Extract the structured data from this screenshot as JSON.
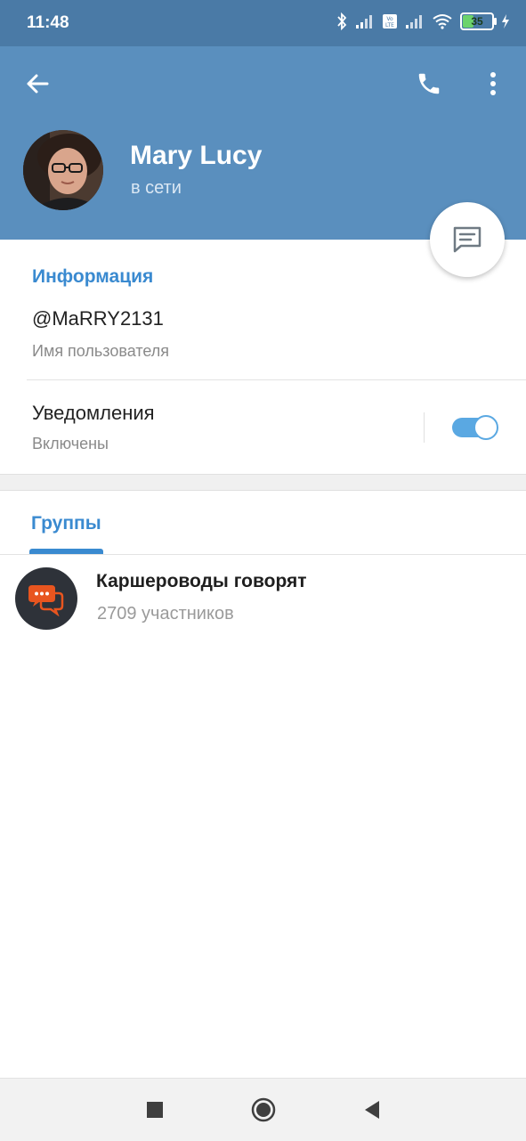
{
  "status_bar": {
    "time": "11:48",
    "battery_percent": "35",
    "icons": [
      "bluetooth-icon",
      "signal-icon",
      "volte-icon",
      "signal-icon",
      "wifi-icon",
      "battery-icon",
      "charging-icon"
    ]
  },
  "header": {
    "icons": [
      "back-arrow-icon",
      "phone-icon",
      "more-vertical-icon"
    ],
    "name": "Mary Lucy",
    "status": "в сети",
    "accent_color": "#5a8fbe",
    "fab_icon": "message-icon"
  },
  "info": {
    "title": "Информация",
    "username": "@MaRRY2131",
    "username_caption": "Имя пользователя",
    "notifications_label": "Уведомления",
    "notifications_status": "Включены",
    "notifications_enabled": true
  },
  "groups": {
    "tab_label": "Группы",
    "items": [
      {
        "name": "Каршероводы говорят",
        "members": "2709 участников",
        "icon": "chat-bubbles-icon"
      }
    ]
  },
  "nav_bar": {
    "icons": [
      "recents-square-icon",
      "home-circle-icon",
      "back-triangle-icon"
    ]
  }
}
